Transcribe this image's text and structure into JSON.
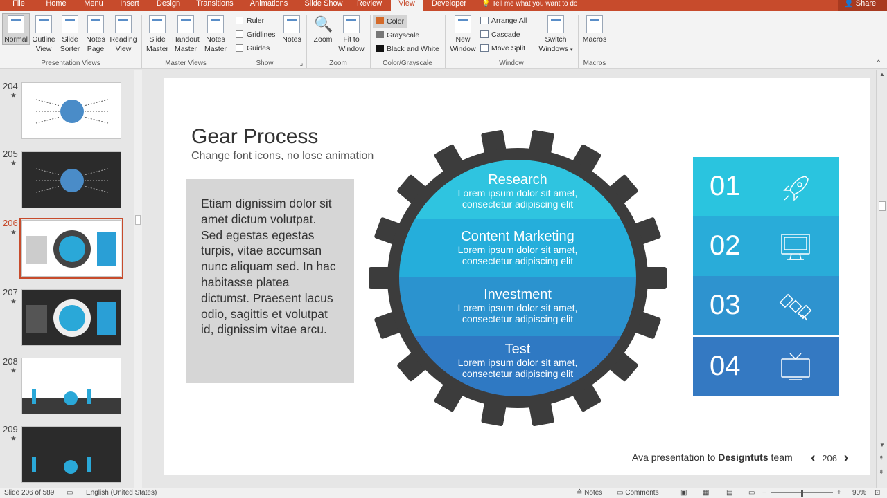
{
  "tabs": [
    "File",
    "Home",
    "Menu",
    "Insert",
    "Design",
    "Transitions",
    "Animations",
    "Slide Show",
    "Review",
    "View",
    "Developer"
  ],
  "tell_me": "Tell me what you want to do",
  "share": "Share",
  "ribbon": {
    "presentation_views": {
      "label": "Presentation Views",
      "buttons": [
        [
          "Normal",
          ""
        ],
        [
          "Outline",
          "View"
        ],
        [
          "Slide",
          "Sorter"
        ],
        [
          "Notes",
          "Page"
        ],
        [
          "Reading",
          "View"
        ]
      ]
    },
    "master_views": {
      "label": "Master Views",
      "buttons": [
        [
          "Slide",
          "Master"
        ],
        [
          "Handout",
          "Master"
        ],
        [
          "Notes",
          "Master"
        ]
      ]
    },
    "show": {
      "label": "Show",
      "checks": [
        "Ruler",
        "Gridlines",
        "Guides"
      ],
      "notes": "Notes"
    },
    "zoom": {
      "label": "Zoom",
      "buttons": [
        [
          "Zoom",
          ""
        ],
        [
          "Fit to",
          "Window"
        ]
      ]
    },
    "color": {
      "label": "Color/Grayscale",
      "items": [
        "Color",
        "Grayscale",
        "Black and White"
      ]
    },
    "window": {
      "label": "Window",
      "new_window": [
        "New",
        "Window"
      ],
      "items": [
        "Arrange All",
        "Cascade",
        "Move Split"
      ],
      "switch": [
        "Switch",
        "Windows"
      ]
    },
    "macros": {
      "label": "Macros",
      "button": "Macros"
    }
  },
  "thumbnails": [
    {
      "num": "204",
      "star": "★",
      "dark": false
    },
    {
      "num": "205",
      "star": "★",
      "dark": true
    },
    {
      "num": "206",
      "star": "★",
      "dark": false,
      "selected": true
    },
    {
      "num": "207",
      "star": "★",
      "dark": true
    },
    {
      "num": "208",
      "star": "★",
      "dark": false
    },
    {
      "num": "209",
      "star": "★",
      "dark": true
    }
  ],
  "slide": {
    "title": "Gear Process",
    "subtitle": "Change font icons, no lose animation",
    "body": "Etiam dignissim dolor sit amet dictum volutpat. Sed egestas egestas turpis, vitae accumsan nunc aliquam sed. In hac habitasse platea dictumst. Praesent lacus odio, sagittis et volutpat id, dignissim vitae arcu.",
    "segments": [
      {
        "title": "Research",
        "line1": "Lorem ipsum dolor sit amet,",
        "line2": "consectetur adipiscing elit",
        "color": "#2fc4e0"
      },
      {
        "title": "Content Marketing",
        "line1": "Lorem ipsum dolor sit amet,",
        "line2": "consectetur adipiscing elit",
        "color": "#25aedb"
      },
      {
        "title": "Investment",
        "line1": "Lorem ipsum dolor sit amet,",
        "line2": "consectetur adipiscing elit",
        "color": "#2b93cf"
      },
      {
        "title": "Test",
        "line1": "Lorem ipsum dolor sit amet,",
        "line2": "consectetur adipiscing elit",
        "color": "#2f79c3"
      }
    ],
    "numbers": [
      {
        "n": "01",
        "icon": "rocket-icon",
        "color": "#2ac4df"
      },
      {
        "n": "02",
        "icon": "monitor-icon",
        "color": "#29acd9"
      },
      {
        "n": "03",
        "icon": "satellite-icon",
        "color": "#2e93cf"
      },
      {
        "n": "04",
        "icon": "tv-icon",
        "color": "#3479c2"
      }
    ],
    "footer_prefix": "Ava presentation to ",
    "footer_brand": "Designtuts",
    "footer_suffix": " team",
    "page": "206"
  },
  "status": {
    "slide": "Slide 206 of 589",
    "language": "English (United States)",
    "notes": "Notes",
    "comments": "Comments",
    "zoom": "90%"
  }
}
